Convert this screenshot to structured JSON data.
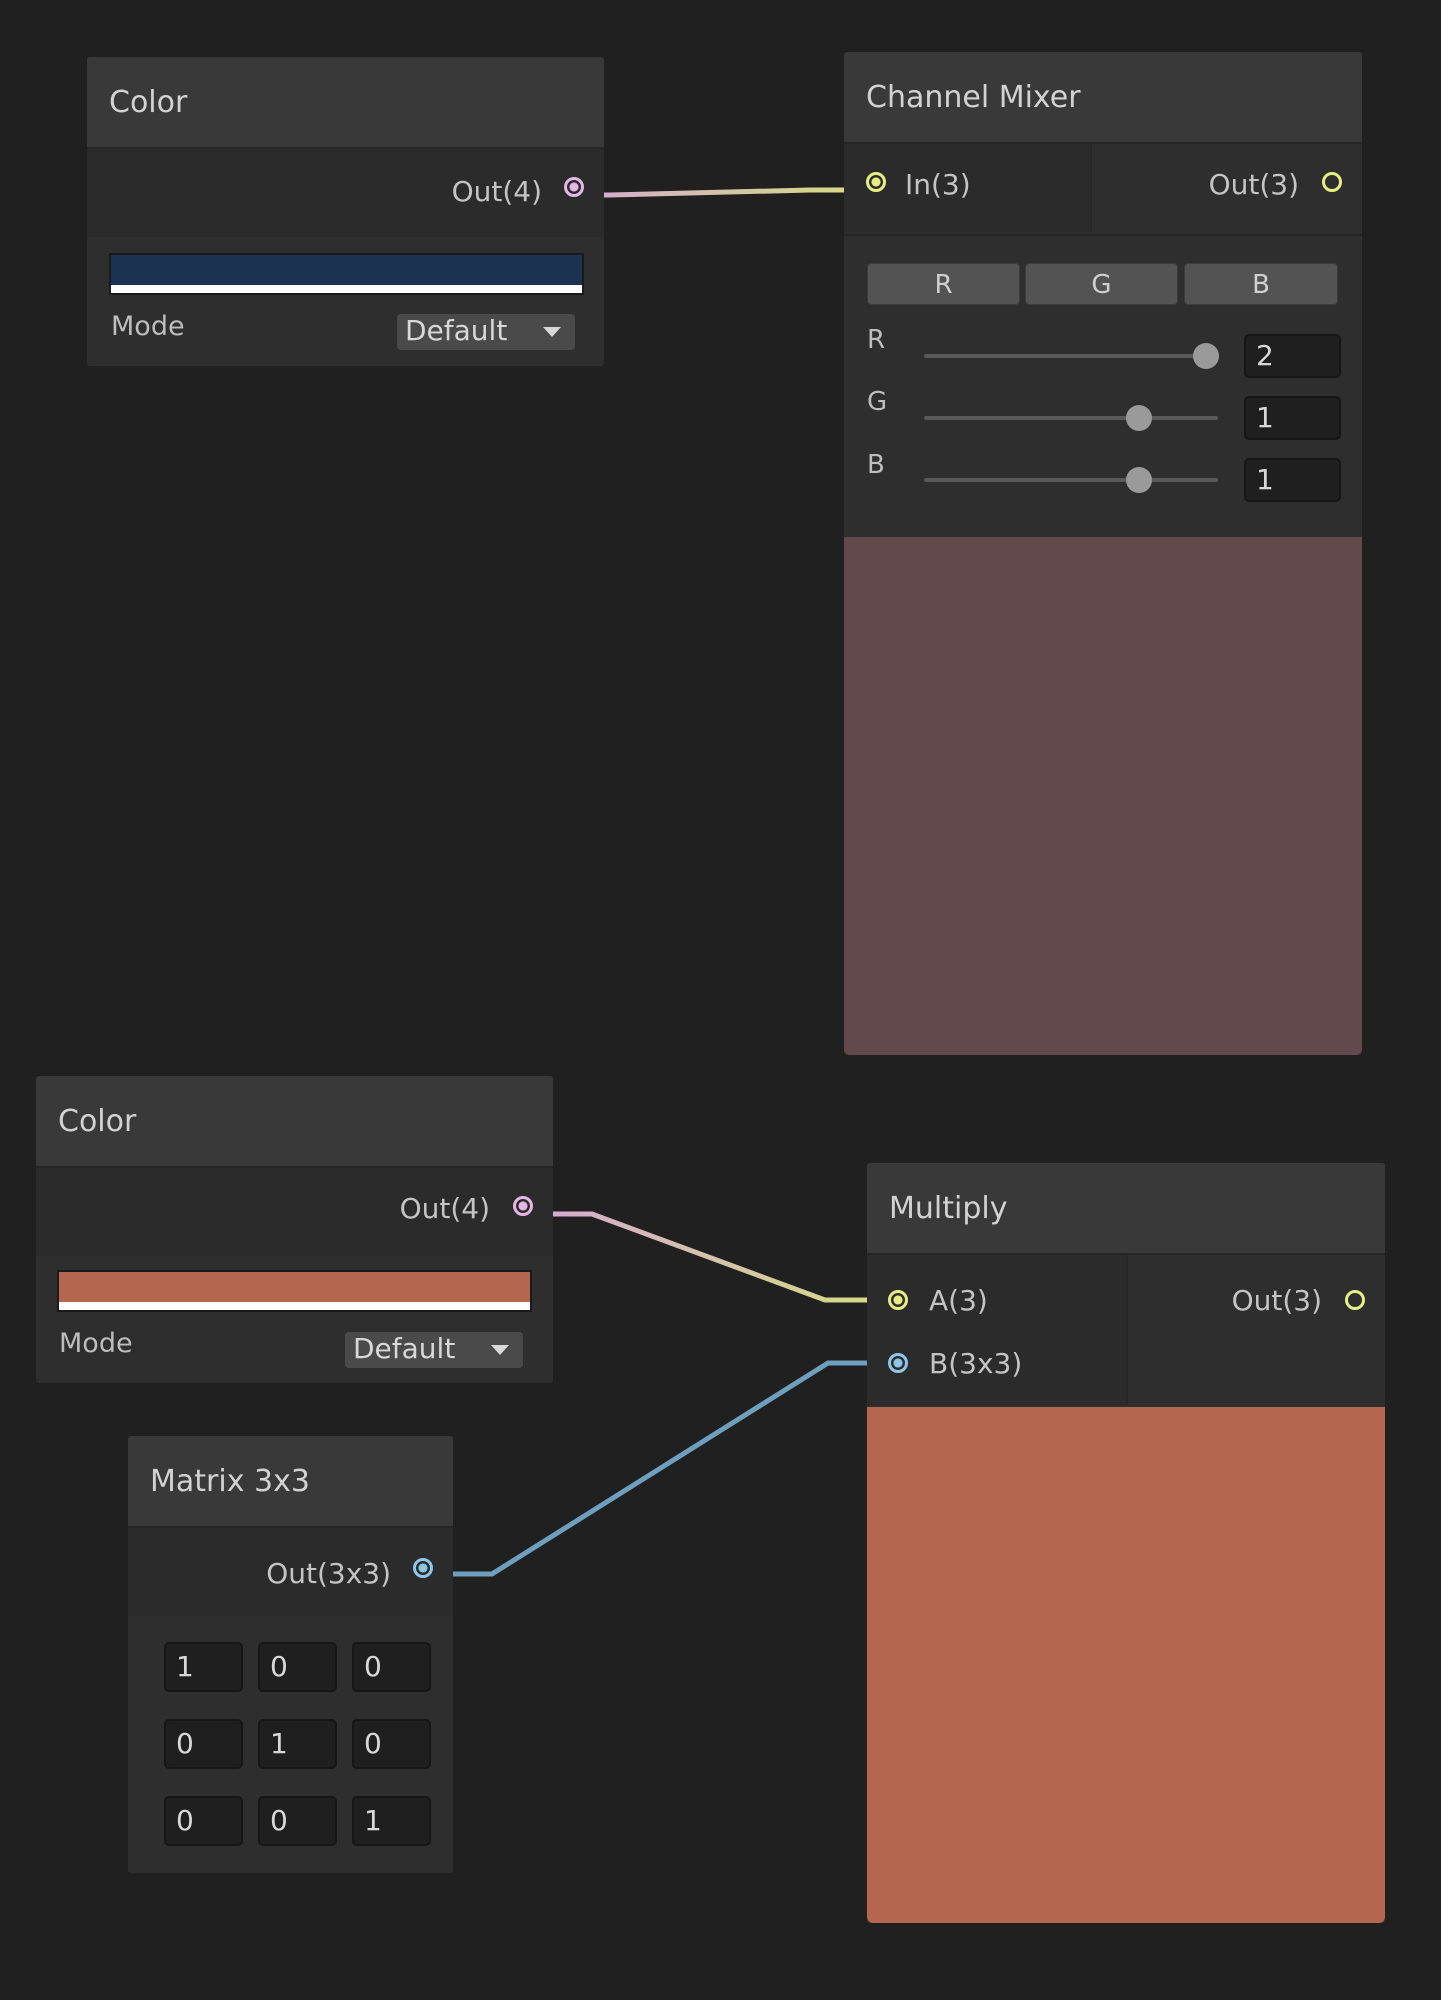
{
  "nodes": {
    "color_top": {
      "title": "Color",
      "output_label": "Out(4)",
      "swatch_color": "#1b3350",
      "mode_label": "Mode",
      "mode_value": "Default"
    },
    "channel_mixer": {
      "title": "Channel Mixer",
      "input_label": "In(3)",
      "output_label": "Out(3)",
      "tabs": [
        "R",
        "G",
        "B"
      ],
      "sliders": [
        {
          "label": "R",
          "value": "2",
          "fraction": 1.0
        },
        {
          "label": "G",
          "value": "1",
          "fraction": 0.73
        },
        {
          "label": "B",
          "value": "1",
          "fraction": 0.73
        }
      ],
      "preview_color": "#63494c"
    },
    "color_bottom": {
      "title": "Color",
      "output_label": "Out(4)",
      "swatch_color": "#b4664e",
      "mode_label": "Mode",
      "mode_value": "Default"
    },
    "matrix": {
      "title": "Matrix 3x3",
      "output_label": "Out(3x3)",
      "cells": [
        [
          "1",
          "0",
          "0"
        ],
        [
          "0",
          "1",
          "0"
        ],
        [
          "0",
          "0",
          "1"
        ]
      ]
    },
    "multiply": {
      "title": "Multiply",
      "input_a_label": "A(3)",
      "input_b_label": "B(3x3)",
      "output_label": "Out(3)",
      "preview_color": "#b4664e"
    }
  },
  "colors": {
    "wire_vector4": "#d4a9d4",
    "wire_vector3": "#d6dc80",
    "wire_matrix": "#6e9fbf",
    "canvas_bg": "#202020"
  }
}
